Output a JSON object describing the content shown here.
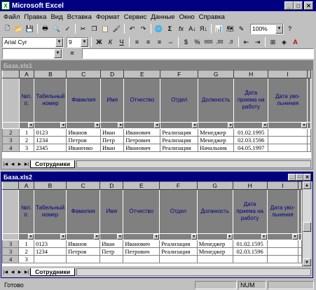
{
  "app": {
    "title": "Microsoft Excel"
  },
  "menu": [
    "Файл",
    "Правка",
    "Вид",
    "Вставка",
    "Формат",
    "Сервис",
    "Данные",
    "Окно",
    "Справка"
  ],
  "toolbar": {
    "zoom": "100%",
    "font_name": "Arial Cyr",
    "font_size": "9",
    "bold": "Ж",
    "italic": "К",
    "underline": "Ч",
    "currency": "$",
    "percent": "%",
    "thousands": "000",
    "sum": "Σ",
    "fx": "fx",
    "sort_asc": "А↓",
    "sort_desc": "Я↓"
  },
  "formula_bar": {
    "name_box": "",
    "equals": "="
  },
  "columns": [
    "A",
    "B",
    "C",
    "D",
    "E",
    "F",
    "G",
    "H",
    "I"
  ],
  "headers": [
    "№п. п.",
    "Табельный номер",
    "Фамилия",
    "Имя",
    "Отчество",
    "Отдел",
    "Должность",
    "Дата приема на работу",
    "Дата уво- льнения"
  ],
  "wb1": {
    "title": "База.xls1",
    "rows": [
      {
        "num": "2",
        "cells": [
          "1",
          "0123",
          "Иванов",
          "Иван",
          "Иванович",
          "Реализация",
          "Менеджер",
          "01.02.1995",
          ""
        ]
      },
      {
        "num": "3",
        "cells": [
          "2",
          "1234",
          "Петров",
          "Петр",
          "Петрович",
          "Реализация",
          "Менеджер",
          "02.03.1596",
          ""
        ]
      },
      {
        "num": "4",
        "cells": [
          "3",
          "2345",
          "Иваненко",
          "Иван",
          "Иванович",
          "Реализация",
          "Начальник",
          "04.05.1997",
          ""
        ]
      }
    ],
    "sheet_tab": "Сотрудники"
  },
  "wb2": {
    "title": "База.xls2",
    "rows": [
      {
        "num": "3",
        "cells": [
          "1",
          "0123",
          "Иванов",
          "Иван",
          "Иванович",
          "Реализация",
          "Менеджер",
          "01.02.1595",
          ""
        ]
      },
      {
        "num": "3",
        "cells": [
          "2",
          "1234",
          "Петров",
          "Петр",
          "Петрович",
          "Реализация",
          "Менеджер",
          "02.03.1596",
          ""
        ]
      },
      {
        "num": "4",
        "cells": [
          "3",
          "",
          "",
          "",
          "",
          "",
          "",
          "",
          ""
        ]
      }
    ],
    "sheet_tab": "Сотрудники"
  },
  "status": {
    "ready": "Готово",
    "num": "NUM"
  }
}
